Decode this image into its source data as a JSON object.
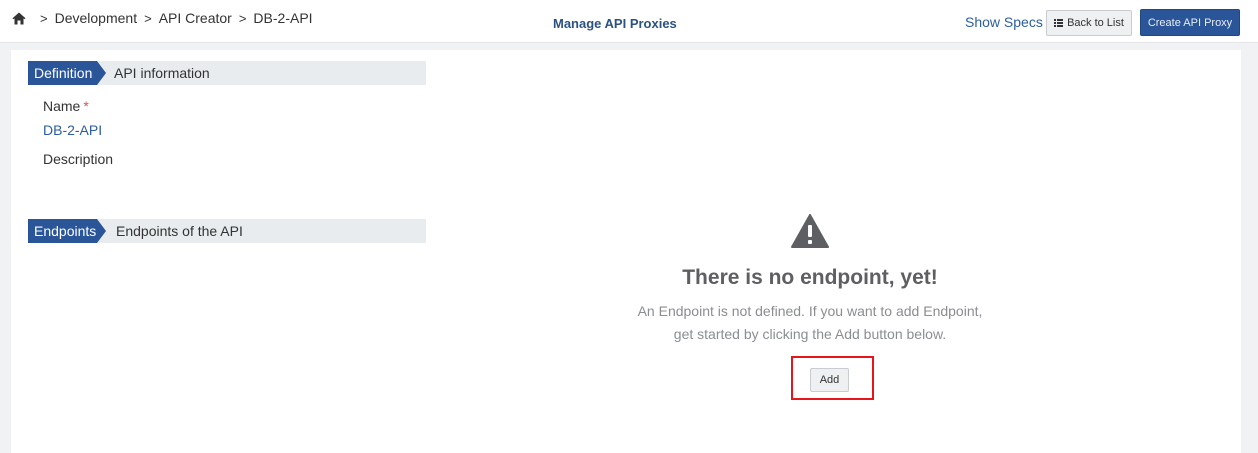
{
  "breadcrumb": {
    "items": [
      "Development",
      "API Creator",
      "DB-2-API"
    ],
    "separator": ">"
  },
  "header": {
    "title": "Manage API Proxies",
    "show_specs": "Show Specs",
    "back_label": "Back to List",
    "create_label": "Create API Proxy"
  },
  "definition": {
    "tag": "Definition",
    "title": "API information",
    "name_label": "Name",
    "required_mark": "*",
    "name_value": "DB-2-API",
    "description_label": "Description"
  },
  "endpoints": {
    "tag": "Endpoints",
    "title": "Endpoints of the API"
  },
  "empty_state": {
    "icon": "warning-icon",
    "title": "There is no endpoint, yet!",
    "line1": "An Endpoint is not defined. If you want to add Endpoint,",
    "line2": "get started by clicking the Add button below.",
    "add_label": "Add"
  },
  "colors": {
    "brand": "#2a5599",
    "link": "#2c5e9e",
    "highlight": "#e8141b",
    "required": "#d9534f"
  }
}
